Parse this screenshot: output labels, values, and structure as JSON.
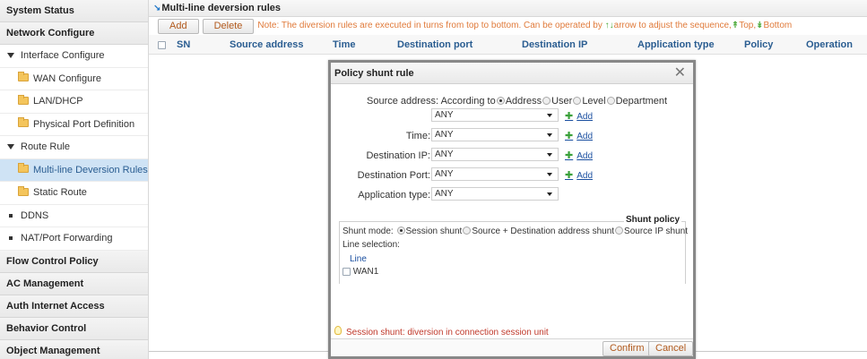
{
  "sidebar": {
    "sections": [
      {
        "label": "System Status"
      },
      {
        "label": "Network Configure"
      }
    ],
    "interface_group": "Interface Configure",
    "interface_items": [
      "WAN Configure",
      "LAN/DHCP",
      "Physical Port Definition"
    ],
    "route_group": "Route Rule",
    "route_items": [
      "Multi-line Deversion Rules",
      "Static Route"
    ],
    "ddns": "DDNS",
    "nat": "NAT/Port Forwarding",
    "bottom_sections": [
      "Flow Control Policy",
      "AC Management",
      "Auth Internet Access",
      "Behavior Control",
      "Object Management"
    ]
  },
  "main": {
    "title": "Multi-line deversion rules",
    "toolbar": {
      "add_label": "Add",
      "delete_label": "Delete",
      "note_prefix": "Note: The diversion rules are executed in turns from top to bottom. Can be operated by",
      "note_mid": "arrow to adjust the sequence,",
      "top_label": "Top,",
      "bottom_label": "Bottom"
    },
    "table_headers": {
      "sn": "SN",
      "source": "Source address",
      "time": "Time",
      "dest_port": "Destination port",
      "dest_ip": "Destination IP",
      "app_type": "Application type",
      "policy": "Policy",
      "operation": "Operation"
    }
  },
  "modal": {
    "title": "Policy shunt rule",
    "source_label": "Source address:",
    "according_to": "According to",
    "radio_address": "Address",
    "radio_user": "User",
    "radio_level": "Level",
    "radio_department": "Department",
    "source_value": "ANY",
    "add_label": "Add",
    "time_label": "Time:",
    "time_value": "ANY",
    "dest_ip_label": "Destination IP:",
    "dest_ip_value": "ANY",
    "dest_port_label": "Destination Port:",
    "dest_port_value": "ANY",
    "app_type_label": "Application type:",
    "app_type_value": "ANY",
    "shunt_policy_legend": "Shunt policy",
    "shunt_mode_label": "Shunt mode:",
    "mode_session": "Session shunt",
    "mode_src_dst": "Source + Destination address shunt",
    "mode_src_ip": "Source IP shunt",
    "line_selection": "Line selection:",
    "line_header": "Line",
    "wan1": "WAN1",
    "hint": "Session shunt: diversion in connection session unit",
    "confirm": "Confirm",
    "cancel": "Cancel"
  }
}
